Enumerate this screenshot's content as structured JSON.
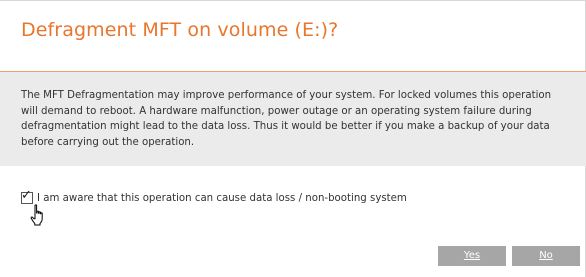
{
  "dialog": {
    "title": "Defragment MFT on volume (E:)?",
    "message": "The MFT Defragmentation may improve performance of your system. For locked volumes this operation will demand to reboot. A hardware malfunction, power outage or an operating system failure during defragmentation might lead to the data loss. Thus it would be better if you make a backup of your data before carrying out the operation.",
    "checkbox": {
      "label": "I am aware that this operation can cause data loss / non-booting system",
      "checked": true
    },
    "buttons": {
      "yes_label": "Yes",
      "no_label": "No"
    }
  },
  "colors": {
    "accent": "#e8762d",
    "panel": "#ebebeb",
    "button": "#a6a6a6"
  },
  "icons": {
    "cursor": "hand-pointer-icon",
    "check": "checkmark-icon"
  }
}
